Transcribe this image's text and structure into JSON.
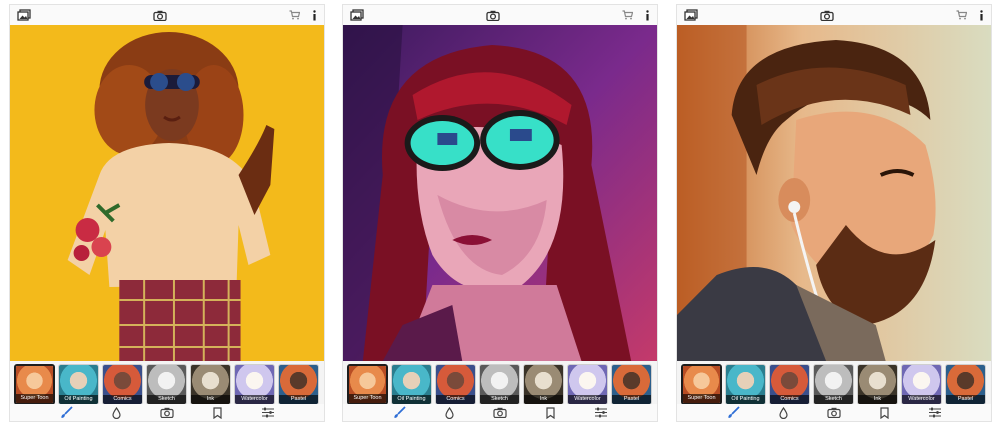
{
  "screens": [
    {
      "id": "screen-1",
      "topbar": {
        "left_icon": "gallery-icon",
        "center_icon": "camera-icon",
        "right_icons": [
          "cart-icon",
          "info-icon"
        ]
      },
      "photo": {
        "description_icon": "stylized-portrait-curly-hair-sunglasses",
        "background": "#f2c51c"
      },
      "filters": [
        {
          "label": "Super Toon",
          "active": true
        },
        {
          "label": "Oil Painting",
          "active": false
        },
        {
          "label": "Comics",
          "active": false
        },
        {
          "label": "Sketch",
          "active": false
        },
        {
          "label": "Ink",
          "active": false
        },
        {
          "label": "Watercolor",
          "active": false
        },
        {
          "label": "Pastel",
          "active": false
        }
      ],
      "bottombar": {
        "icons": [
          "brush-icon",
          "drop-icon",
          "camera-icon",
          "bookmark-icon",
          "sliders-icon"
        ],
        "accent": "#2f6fd6"
      }
    },
    {
      "id": "screen-2",
      "topbar": {
        "left_icon": "gallery-icon",
        "center_icon": "camera-icon",
        "right_icons": [
          "cart-icon",
          "info-icon"
        ]
      },
      "photo": {
        "description_icon": "stylized-portrait-red-hair-reflective-sunglasses",
        "background": "#7a2a8c"
      },
      "filters": [
        {
          "label": "Super Toon",
          "active": true
        },
        {
          "label": "Oil Painting",
          "active": false
        },
        {
          "label": "Comics",
          "active": false
        },
        {
          "label": "Sketch",
          "active": false
        },
        {
          "label": "Ink",
          "active": false
        },
        {
          "label": "Watercolor",
          "active": false
        },
        {
          "label": "Pastel",
          "active": false
        }
      ],
      "bottombar": {
        "icons": [
          "brush-icon",
          "drop-icon",
          "camera-icon",
          "bookmark-icon",
          "sliders-icon"
        ],
        "accent": "#2f6fd6"
      }
    },
    {
      "id": "screen-3",
      "topbar": {
        "left_icon": "gallery-icon",
        "center_icon": "camera-icon",
        "right_icons": [
          "cart-icon",
          "info-icon"
        ]
      },
      "photo": {
        "description_icon": "stylized-portrait-bearded-man-earphones",
        "background": "#e7b98b"
      },
      "filters": [
        {
          "label": "Super Toon",
          "active": true
        },
        {
          "label": "Oil Painting",
          "active": false
        },
        {
          "label": "Comics",
          "active": false
        },
        {
          "label": "Sketch",
          "active": false
        },
        {
          "label": "Ink",
          "active": false
        },
        {
          "label": "Watercolor",
          "active": false
        },
        {
          "label": "Pastel",
          "active": false
        }
      ],
      "bottombar": {
        "icons": [
          "brush-icon",
          "drop-icon",
          "camera-icon",
          "bookmark-icon",
          "sliders-icon"
        ],
        "accent": "#2f6fd6"
      }
    }
  ],
  "thumb_colors": [
    "#e88a4b",
    "#49b7c9",
    "#d65a3a",
    "#bdbdbd",
    "#9a8b74",
    "#cfc7ee",
    "#d96a39"
  ]
}
